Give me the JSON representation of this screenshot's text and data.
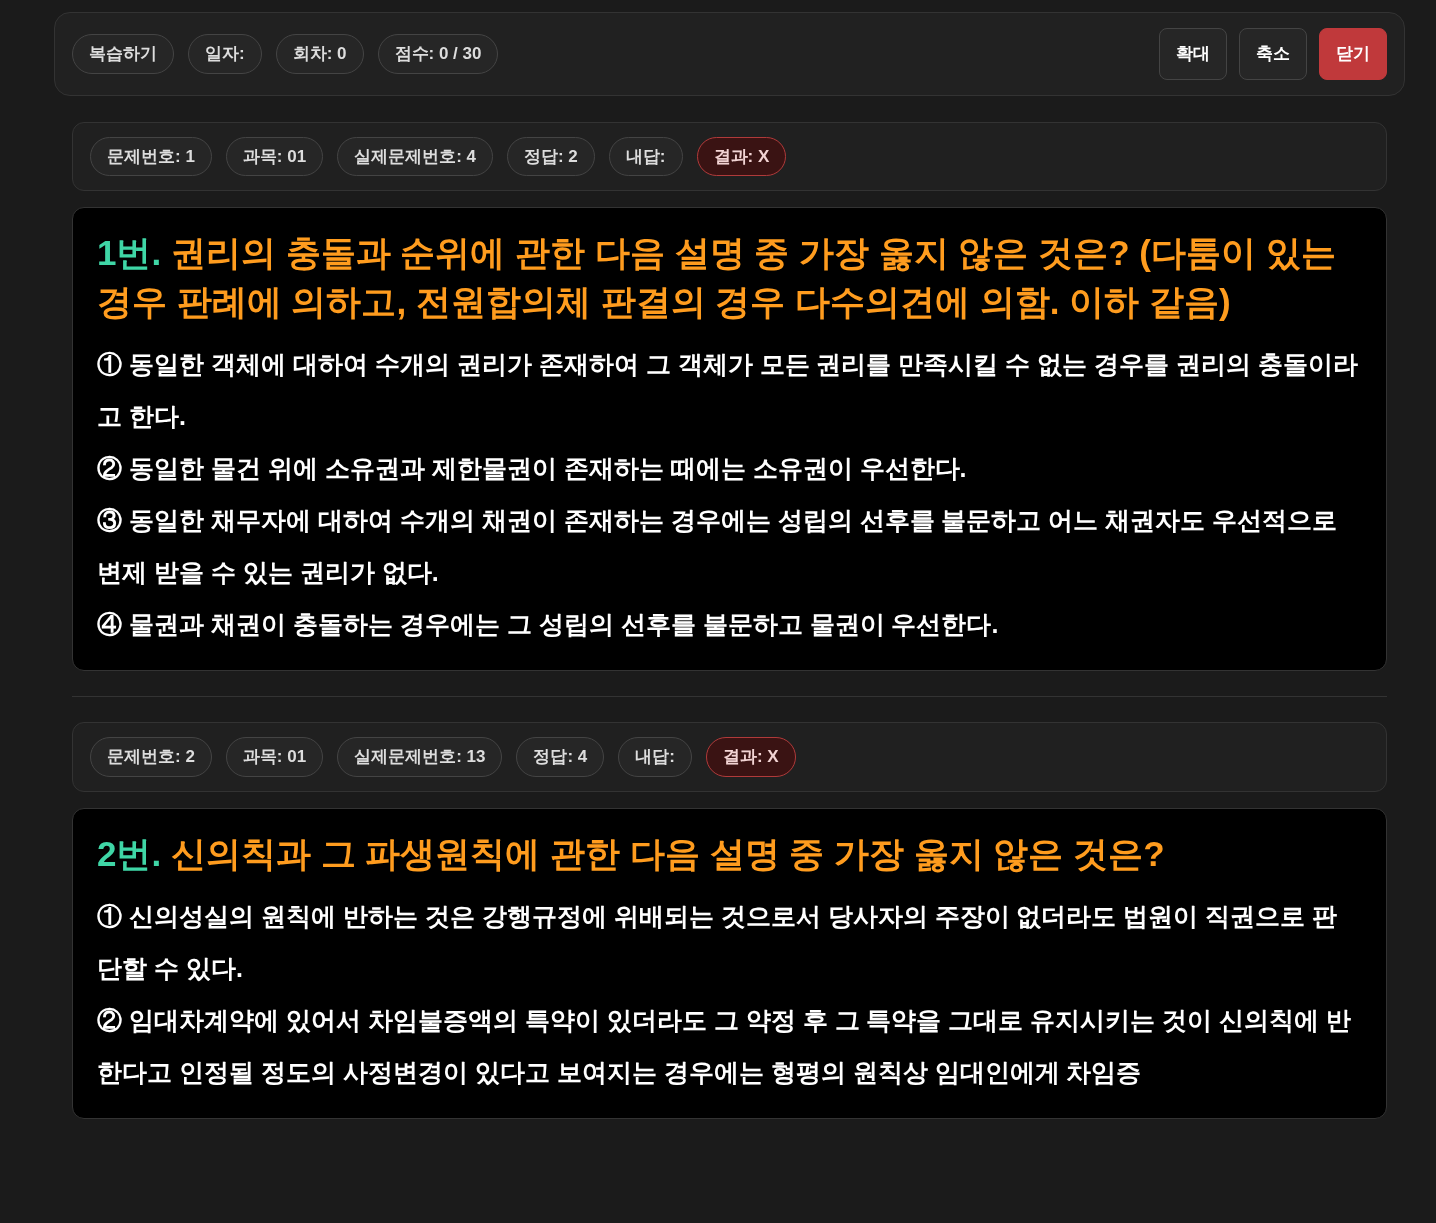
{
  "top_bar": {
    "chips": [
      "복습하기",
      "일자:",
      "회차: 0",
      "점수: 0 / 30"
    ],
    "buttons": [
      {
        "label": "확대",
        "kind": "default"
      },
      {
        "label": "축소",
        "kind": "default"
      },
      {
        "label": "닫기",
        "kind": "danger"
      }
    ]
  },
  "questions": [
    {
      "meta": [
        {
          "label": "문제번호: 1",
          "kind": "plain"
        },
        {
          "label": "과목: 01",
          "kind": "plain"
        },
        {
          "label": "실제문제번호: 4",
          "kind": "plain"
        },
        {
          "label": "정답: 2",
          "kind": "plain"
        },
        {
          "label": "내답:",
          "kind": "plain"
        },
        {
          "label": "결과: X",
          "kind": "result"
        }
      ],
      "number": "1번.",
      "title": "권리의 충돌과 순위에 관한 다음 설명 중 가장 옳지 않은 것은? (다툼이 있는 경우 판례에 의하고, 전원합의체 판결의 경우 다수의견에 의함. 이하 같음)",
      "options": [
        "① 동일한 객체에 대하여 수개의 권리가 존재하여 그 객체가 모든 권리를 만족시킬 수 없는 경우를 권리의 충돌이라고 한다.",
        "② 동일한 물건 위에 소유권과 제한물권이 존재하는 때에는 소유권이 우선한다.",
        "③ 동일한 채무자에 대하여 수개의 채권이 존재하는 경우에는 성립의 선후를 불문하고 어느 채권자도 우선적으로 변제 받을 수 있는 권리가 없다.",
        "④ 물권과 채권이 충돌하는 경우에는 그 성립의 선후를 불문하고 물권이 우선한다."
      ]
    },
    {
      "meta": [
        {
          "label": "문제번호: 2",
          "kind": "plain"
        },
        {
          "label": "과목: 01",
          "kind": "plain"
        },
        {
          "label": "실제문제번호: 13",
          "kind": "plain"
        },
        {
          "label": "정답: 4",
          "kind": "plain"
        },
        {
          "label": "내답:",
          "kind": "plain"
        },
        {
          "label": "결과: X",
          "kind": "result"
        }
      ],
      "number": "2번.",
      "title": "신의칙과 그 파생원칙에 관한 다음 설명 중 가장 옳지 않은 것은?",
      "options": [
        "① 신의성실의 원칙에 반하는 것은 강행규정에 위배되는 것으로서 당사자의 주장이 없더라도 법원이 직권으로 판단할 수 있다.",
        "② 임대차계약에 있어서 차임불증액의 특약이 있더라도 그 약정 후 그 특약을 그대로 유지시키는 것이 신의칙에 반한다고 인정될 정도의 사정변경이 있다고 보여지는 경우에는 형평의 원칙상 임대인에게 차임증"
      ]
    }
  ]
}
